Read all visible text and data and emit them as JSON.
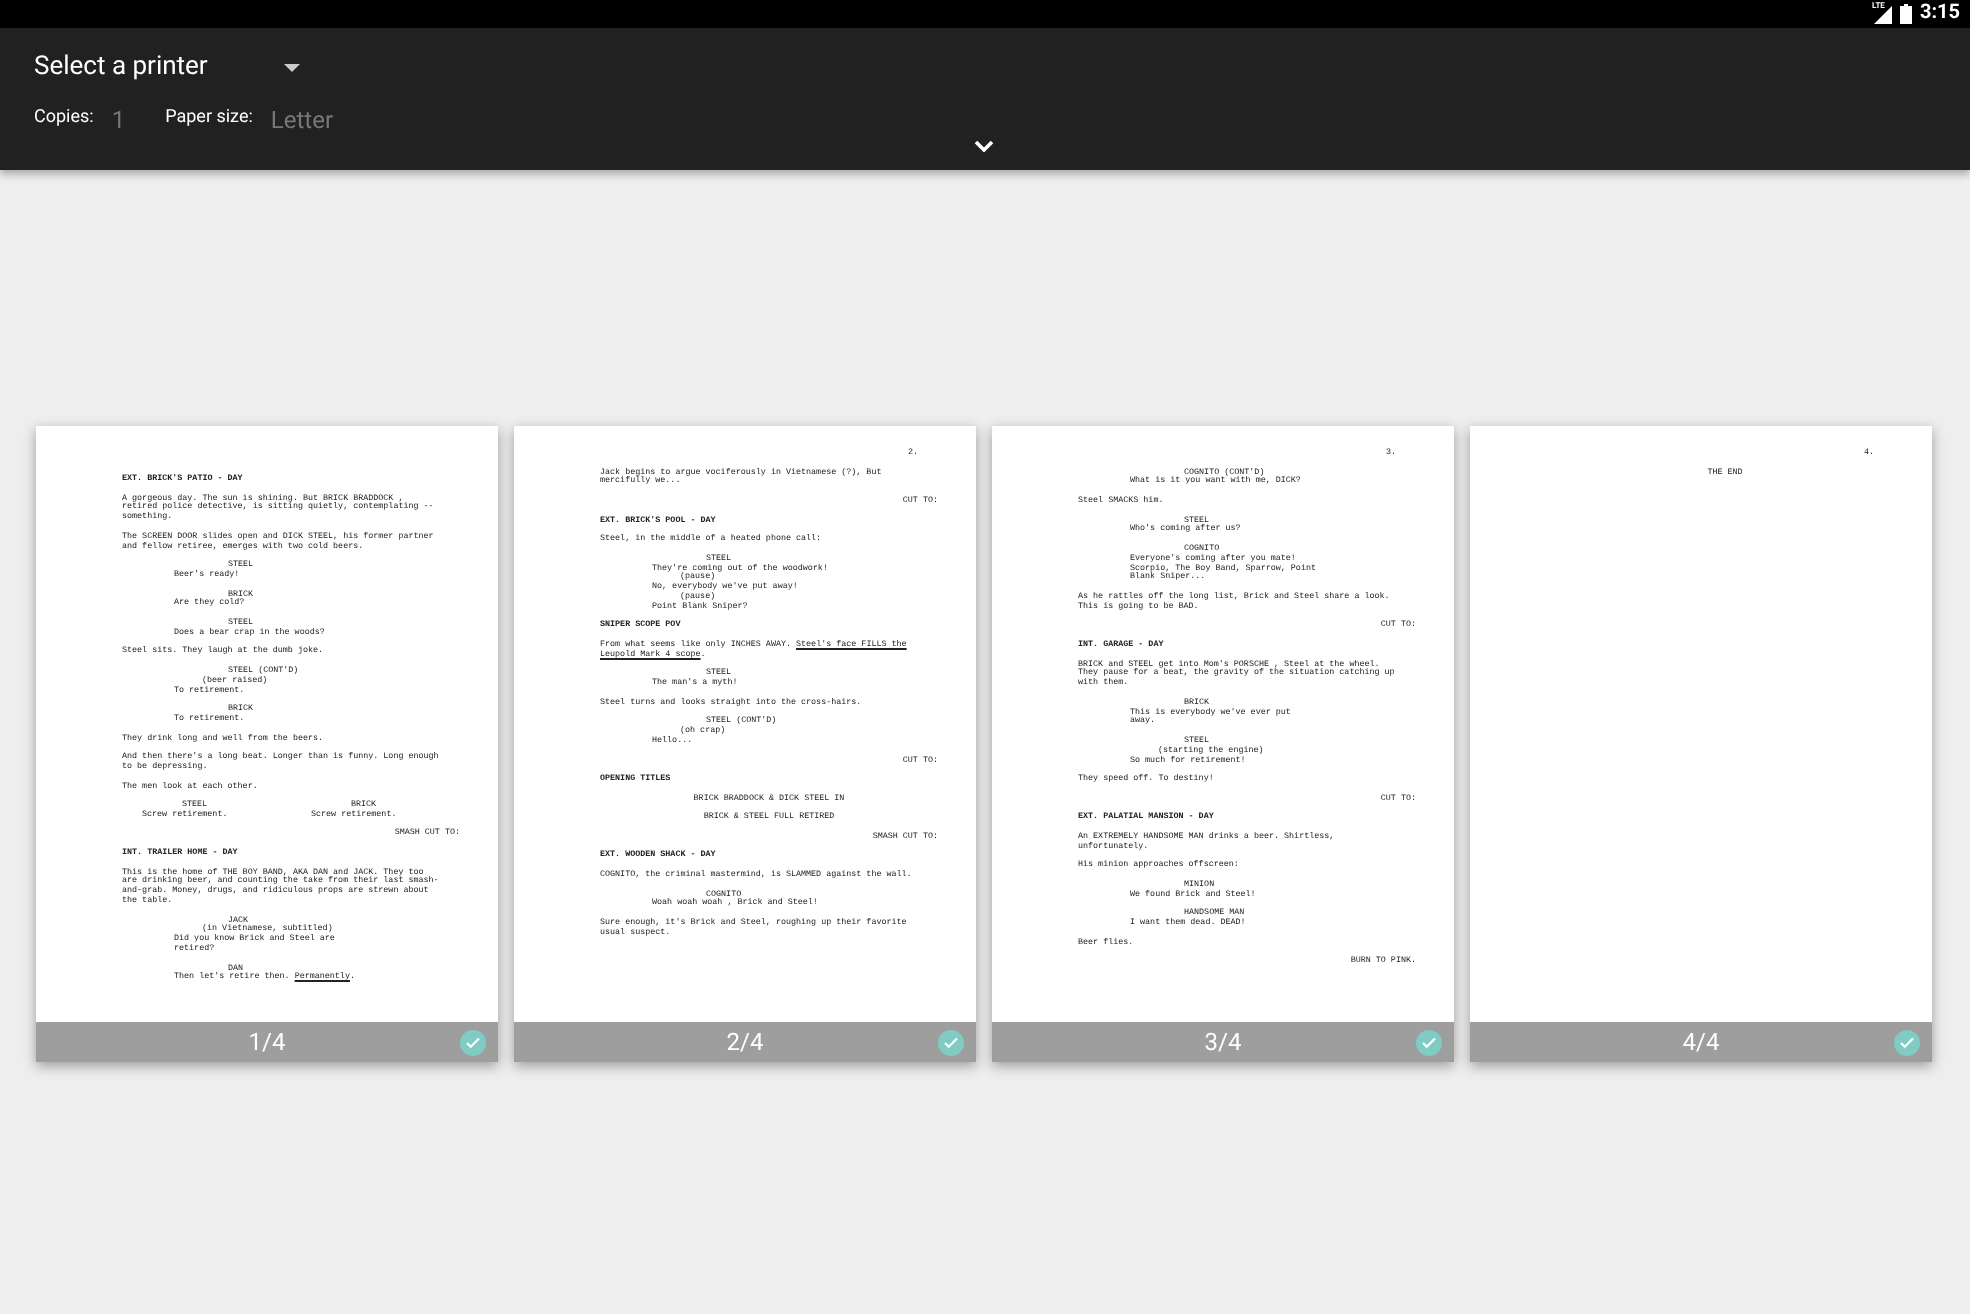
{
  "status_bar": {
    "time": "3:15",
    "network": "LTE"
  },
  "print_options": {
    "printer": "Select a printer",
    "copies_label": "Copies:",
    "copies": "1",
    "paper_size_label": "Paper size:",
    "paper_size": "Letter"
  },
  "pages": [
    {
      "label": "1/4",
      "selected": true,
      "blocks": [
        {
          "kind": "heading",
          "lines": [
            "EXT. BRICK'S PATIO - DAY"
          ]
        },
        {
          "kind": "action",
          "lines": [
            "A gorgeous day. The sun is shining. But BRICK BRADDOCK ,",
            "retired police detective, is sitting quietly, contemplating --",
            "something."
          ]
        },
        {
          "kind": "action",
          "lines": [
            "The SCREEN DOOR slides open and DICK STEEL, his former partner",
            "and fellow retiree, emerges with two cold beers."
          ]
        },
        {
          "kind": "character",
          "lines": [
            "STEEL"
          ]
        },
        {
          "kind": "dialogue",
          "lines": [
            "Beer's ready!"
          ]
        },
        {
          "kind": "character",
          "lines": [
            "BRICK"
          ]
        },
        {
          "kind": "dialogue",
          "lines": [
            "Are they cold?"
          ]
        },
        {
          "kind": "character",
          "lines": [
            "STEEL"
          ]
        },
        {
          "kind": "dialogue",
          "lines": [
            "Does a bear crap in the woods?"
          ]
        },
        {
          "kind": "action",
          "lines": [
            "Steel sits. They laugh at the dumb joke."
          ]
        },
        {
          "kind": "character",
          "lines": [
            "STEEL (CONT'D)"
          ]
        },
        {
          "kind": "parenthetical",
          "lines": [
            "(beer raised)"
          ]
        },
        {
          "kind": "dialogue",
          "lines": [
            "To retirement."
          ]
        },
        {
          "kind": "character",
          "lines": [
            "BRICK"
          ]
        },
        {
          "kind": "dialogue",
          "lines": [
            "To retirement."
          ]
        },
        {
          "kind": "action",
          "lines": [
            "They drink long and well from the beers."
          ]
        },
        {
          "kind": "action",
          "lines": [
            "And then there's a long beat. Longer than is funny. Long enough",
            "to be depressing."
          ]
        },
        {
          "kind": "action",
          "lines": [
            "The men look at each other."
          ]
        },
        {
          "kind": "dual",
          "columns": [
            {
              "character": "STEEL",
              "lines": [
                "Screw retirement."
              ]
            },
            {
              "character": "BRICK",
              "lines": [
                "Screw retirement."
              ]
            }
          ]
        },
        {
          "kind": "transition",
          "lines": [
            "SMASH CUT TO:"
          ]
        },
        {
          "kind": "heading",
          "lines": [
            "INT. TRAILER HOME - DAY"
          ]
        },
        {
          "kind": "action",
          "lines": [
            "This is the home of THE BOY BAND, AKA DAN and JACK. They too",
            "are drinking beer, and counting the take from their last smash-",
            "and-grab. Money, drugs, and ridiculous props are strewn about",
            "the table."
          ]
        },
        {
          "kind": "character",
          "lines": [
            "JACK"
          ]
        },
        {
          "kind": "parenthetical",
          "lines": [
            "(in Vietnamese, subtitled)"
          ]
        },
        {
          "kind": "dialogue",
          "lines": [
            "Did you know Brick and Steel are",
            "retired?"
          ]
        },
        {
          "kind": "character",
          "lines": [
            "DAN"
          ]
        },
        {
          "kind": "dialogue",
          "lines": [
            [
              {
                "text": "Then let's retire then. ",
                "underlined": false
              },
              {
                "text": "Permanently",
                "underlined": true
              },
              {
                "text": ".",
                "underlined": false
              }
            ]
          ]
        }
      ]
    },
    {
      "label": "2/4",
      "selected": true,
      "number": "2.",
      "blocks": [
        {
          "kind": "action",
          "lines": [
            "Jack begins to argue vociferously in Vietnamese (?), But",
            "mercifully we..."
          ]
        },
        {
          "kind": "transition",
          "lines": [
            "CUT TO:"
          ]
        },
        {
          "kind": "heading",
          "lines": [
            "EXT. BRICK'S POOL - DAY"
          ]
        },
        {
          "kind": "action",
          "lines": [
            "Steel, in the middle of a heated phone call:"
          ]
        },
        {
          "kind": "character",
          "lines": [
            "STEEL"
          ]
        },
        {
          "kind": "dialogue",
          "lines": [
            "They're coming out of the woodwork!"
          ]
        },
        {
          "kind": "parenthetical",
          "lines": [
            "(pause)"
          ]
        },
        {
          "kind": "dialogue",
          "lines": [
            "No, everybody we've put away!"
          ]
        },
        {
          "kind": "parenthetical",
          "lines": [
            "(pause)"
          ]
        },
        {
          "kind": "dialogue",
          "lines": [
            "Point Blank Sniper?"
          ]
        },
        {
          "kind": "heading",
          "lines": [
            "SNIPER SCOPE POV"
          ]
        },
        {
          "kind": "action",
          "lines": [
            [
              {
                "text": "From what seems like only INCHES AWAY. ",
                "underlined": false
              },
              {
                "text": "Steel's face FILLS the",
                "underlined": true
              }
            ],
            [
              {
                "text": "Leupold Mark 4 scope",
                "underlined": true
              },
              {
                "text": ".",
                "underlined": false
              }
            ]
          ]
        },
        {
          "kind": "character",
          "lines": [
            "STEEL"
          ]
        },
        {
          "kind": "dialogue",
          "lines": [
            "The man's a myth!"
          ]
        },
        {
          "kind": "action",
          "lines": [
            "Steel turns and looks straight into the cross-hairs."
          ]
        },
        {
          "kind": "character",
          "lines": [
            "STEEL (CONT'D)"
          ]
        },
        {
          "kind": "parenthetical",
          "lines": [
            "(oh crap)"
          ]
        },
        {
          "kind": "dialogue",
          "lines": [
            "Hello..."
          ]
        },
        {
          "kind": "transition",
          "lines": [
            "CUT TO:"
          ]
        },
        {
          "kind": "heading",
          "lines": [
            "OPENING TITLES"
          ]
        },
        {
          "kind": "centered",
          "lines": [
            "BRICK BRADDOCK & DICK STEEL IN"
          ]
        },
        {
          "kind": "centered",
          "lines": [
            "BRICK & STEEL FULL RETIRED"
          ]
        },
        {
          "kind": "transition",
          "lines": [
            "SMASH CUT TO:"
          ]
        },
        {
          "kind": "heading",
          "lines": [
            "EXT. WOODEN SHACK - DAY"
          ]
        },
        {
          "kind": "action",
          "lines": [
            "COGNITO, the criminal mastermind, is SLAMMED against the wall."
          ]
        },
        {
          "kind": "character",
          "lines": [
            "COGNITO"
          ]
        },
        {
          "kind": "dialogue",
          "lines": [
            "Woah woah woah , Brick and Steel!"
          ]
        },
        {
          "kind": "action",
          "lines": [
            "Sure enough, it's Brick and Steel, roughing up their favorite",
            "usual suspect."
          ]
        }
      ]
    },
    {
      "label": "3/4",
      "selected": true,
      "number": "3.",
      "blocks": [
        {
          "kind": "character",
          "lines": [
            "COGNITO (CONT'D)"
          ]
        },
        {
          "kind": "dialogue",
          "lines": [
            "What is it you want with me, DICK?"
          ]
        },
        {
          "kind": "action",
          "lines": [
            "Steel SMACKS him."
          ]
        },
        {
          "kind": "character",
          "lines": [
            "STEEL"
          ]
        },
        {
          "kind": "dialogue",
          "lines": [
            "Who's coming after us?"
          ]
        },
        {
          "kind": "character",
          "lines": [
            "COGNITO"
          ]
        },
        {
          "kind": "dialogue",
          "lines": [
            "Everyone's coming after you mate!",
            "Scorpio, The Boy Band, Sparrow, Point",
            "Blank Sniper..."
          ]
        },
        {
          "kind": "action",
          "lines": [
            "As he rattles off the long list, Brick and Steel share a look.",
            "This is going to be BAD."
          ]
        },
        {
          "kind": "transition",
          "lines": [
            "CUT TO:"
          ]
        },
        {
          "kind": "heading",
          "lines": [
            "INT. GARAGE - DAY"
          ]
        },
        {
          "kind": "action",
          "lines": [
            "BRICK and STEEL get into Mom's PORSCHE , Steel at the wheel.",
            "They pause for a beat, the gravity of the situation catching up",
            "with them."
          ]
        },
        {
          "kind": "character",
          "lines": [
            "BRICK"
          ]
        },
        {
          "kind": "dialogue",
          "lines": [
            "This is everybody we've ever put",
            "away."
          ]
        },
        {
          "kind": "character",
          "lines": [
            "STEEL"
          ]
        },
        {
          "kind": "parenthetical",
          "lines": [
            "(starting the engine)"
          ]
        },
        {
          "kind": "dialogue",
          "lines": [
            "So much for retirement!"
          ]
        },
        {
          "kind": "action",
          "lines": [
            "They speed off. To destiny!"
          ]
        },
        {
          "kind": "transition",
          "lines": [
            "CUT TO:"
          ]
        },
        {
          "kind": "heading",
          "lines": [
            "EXT. PALATIAL MANSION - DAY"
          ]
        },
        {
          "kind": "action",
          "lines": [
            "An EXTREMELY HANDSOME MAN drinks a beer. Shirtless,",
            "unfortunately."
          ]
        },
        {
          "kind": "action",
          "lines": [
            "His minion approaches offscreen:"
          ]
        },
        {
          "kind": "character",
          "lines": [
            "MINION"
          ]
        },
        {
          "kind": "dialogue",
          "lines": [
            "We found Brick and Steel!"
          ]
        },
        {
          "kind": "character",
          "lines": [
            "HANDSOME MAN"
          ]
        },
        {
          "kind": "dialogue",
          "lines": [
            "I want them dead. DEAD!"
          ]
        },
        {
          "kind": "action",
          "lines": [
            "Beer flies."
          ]
        },
        {
          "kind": "transition",
          "lines": [
            "BURN TO PINK."
          ]
        }
      ]
    },
    {
      "label": "4/4",
      "selected": true,
      "number": "4.",
      "blocks": [
        {
          "kind": "centered",
          "lines": [
            "THE END"
          ]
        }
      ]
    }
  ]
}
